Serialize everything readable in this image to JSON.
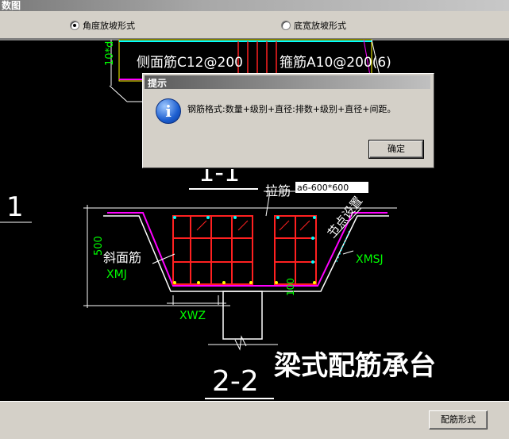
{
  "window": {
    "title": "数图"
  },
  "options": {
    "radio1": {
      "label": "角度放坡形式",
      "checked": true
    },
    "radio2": {
      "label": "底宽放坡形式",
      "checked": false
    }
  },
  "drawing": {
    "side_rebar": "侧面筋C12@200",
    "stirrup": "箍筋A10@200(6)",
    "dim_10d": "10*d",
    "section_1": "1-1",
    "marker_1": "1",
    "tie_bar_label": "拉筋",
    "tie_bar_value": "a6-600*600",
    "node_setting": "节点设置",
    "dim_500": "500",
    "slope_rebar": "斜面筋",
    "xmj": "XMJ",
    "xmsj": "XMSJ",
    "dim_100": "100",
    "xwz": "XWZ",
    "section_2": "2-2",
    "heading": "梁式配筋承台"
  },
  "dialog": {
    "title": "提示",
    "message": "钢筋格式:数量+级别+直径:排数+级别+直径+间距。",
    "ok_label": "确定",
    "icon": "info-icon"
  },
  "footer": {
    "rebar_form_label": "配筋形式"
  },
  "colors": {
    "canvas": "#000000",
    "rebar": "#ff2020",
    "outline": "#ff00ff",
    "dim": "#00ff00",
    "line": "#ffffff"
  }
}
